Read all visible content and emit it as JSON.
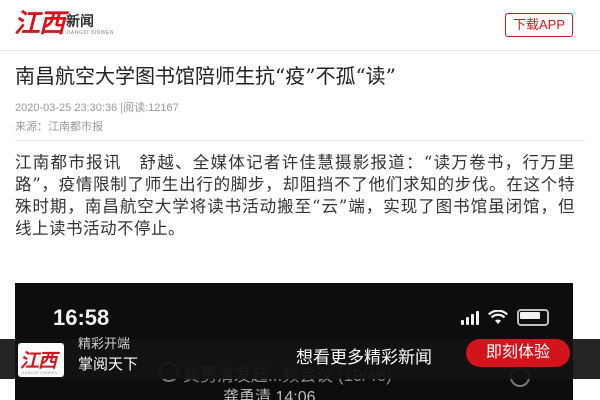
{
  "header": {
    "logo_main": "江西",
    "logo_cn": "新闻",
    "logo_en": "JIANGXI XINWEN",
    "download_label": "下载APP"
  },
  "article": {
    "title": "南昌航空大学图书馆陪师生抗“疫”不孤“读”",
    "datetime": "2020-03-25 23:30:36",
    "reads": "|阅读:12167",
    "source": "来源：江南都市报",
    "body": "江南都市报讯　舒越、全媒体记者许佳慧摄影报道：“读万卷书，行万里路”，疫情限制了师生出行的脚步，却阻挡不了他们求知的步伐。在这个特殊时期，南昌航空大学将读书活动搬至“云”端，实现了图书馆虽闭馆，但线上读书活动不停止。"
  },
  "photo": {
    "time": "16:58",
    "meeting_title": "龚勇清发起...频会议 (19/46)",
    "meeting_sub": "龚勇清 14:06"
  },
  "banner": {
    "line1": "精彩开端",
    "line2": "掌阅天下",
    "promo": "想看更多精彩新闻",
    "button": "即刻体验"
  },
  "colors": {
    "brand_red": "#d4141c",
    "banner_bg": "#121212"
  }
}
